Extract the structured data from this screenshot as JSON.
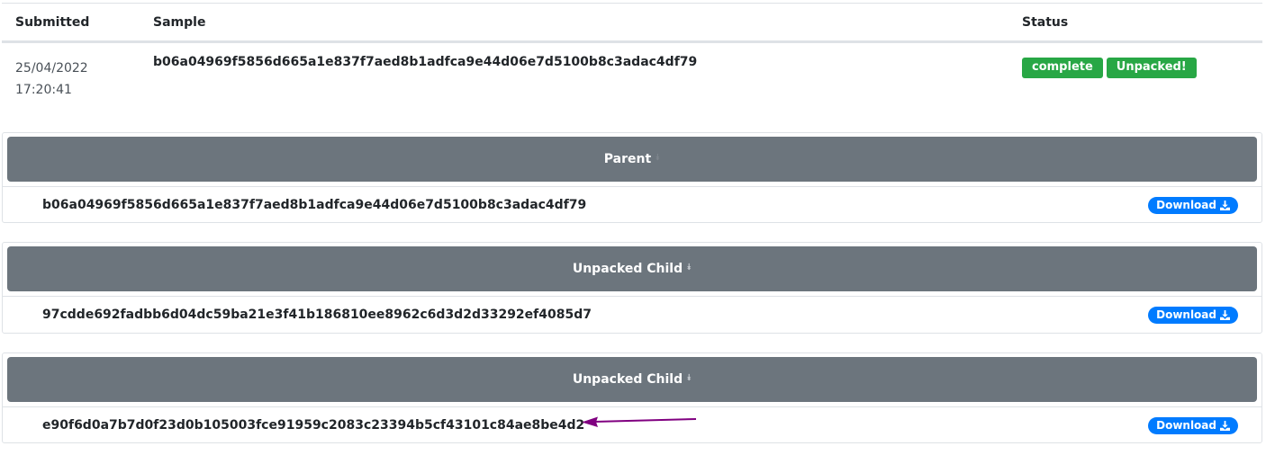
{
  "table": {
    "headers": {
      "submitted": "Submitted",
      "sample": "Sample",
      "status": "Status"
    },
    "row": {
      "date": "25/04/2022",
      "time": "17:20:41",
      "sample": "b06a04969f5856d665a1e837f7aed8b1adfca9e44d06e7d5100b8c3adac4df79",
      "status_badges": [
        "complete",
        "Unpacked!"
      ]
    }
  },
  "cards": [
    {
      "title": "Parent",
      "hash": "b06a04969f5856d665a1e837f7aed8b1adfca9e44d06e7d5100b8c3adac4df79",
      "download_label": "Download"
    },
    {
      "title": "Unpacked Child",
      "hash": "97cdde692fadbb6d04dc59ba21e3f41b186810ee8962c6d3d2d33292ef4085d7",
      "download_label": "Download"
    },
    {
      "title": "Unpacked Child",
      "hash": "e90f6d0a7b7d0f23d0b105003fce91959c2083c23394b5cf43101c84ae8be4d2",
      "download_label": "Download"
    }
  ],
  "colors": {
    "card_header": "#6c757d",
    "badge_success": "#28a745",
    "download_button": "#007bff",
    "annotation_arrow": "#800080"
  },
  "icons": {
    "chevron": "double-chevron-down-icon",
    "download": "download-icon"
  }
}
